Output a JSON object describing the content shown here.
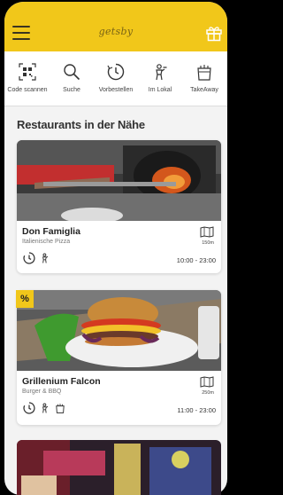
{
  "app": {
    "logo_text": "getsby"
  },
  "header": {
    "menu_icon": "hamburger-menu-icon",
    "gift_icon": "gift-icon",
    "background": "#f1c71a"
  },
  "actions": [
    {
      "label": "Code scannen",
      "icon": "qr-code-icon"
    },
    {
      "label": "Suche",
      "icon": "search-icon"
    },
    {
      "label": "Vorbestellen",
      "icon": "clock-icon"
    },
    {
      "label": "Im Lokal",
      "icon": "waiter-icon"
    },
    {
      "label": "TakeAway",
      "icon": "takeaway-bag-icon"
    }
  ],
  "section": {
    "title": "Restaurants in der Nähe"
  },
  "restaurants": [
    {
      "name": "Don Famiglia",
      "category": "Italienische Pizza",
      "distance": "150m",
      "hours": "10:00 - 23:00",
      "features": [
        "clock-icon",
        "waiter-icon"
      ]
    },
    {
      "name": "Grillenium Falcon",
      "category": "Burger & BBQ",
      "distance": "250m",
      "hours": "11:00 - 23:00",
      "badge": "%",
      "features": [
        "clock-icon",
        "waiter-icon",
        "takeaway-bag-icon"
      ]
    }
  ]
}
